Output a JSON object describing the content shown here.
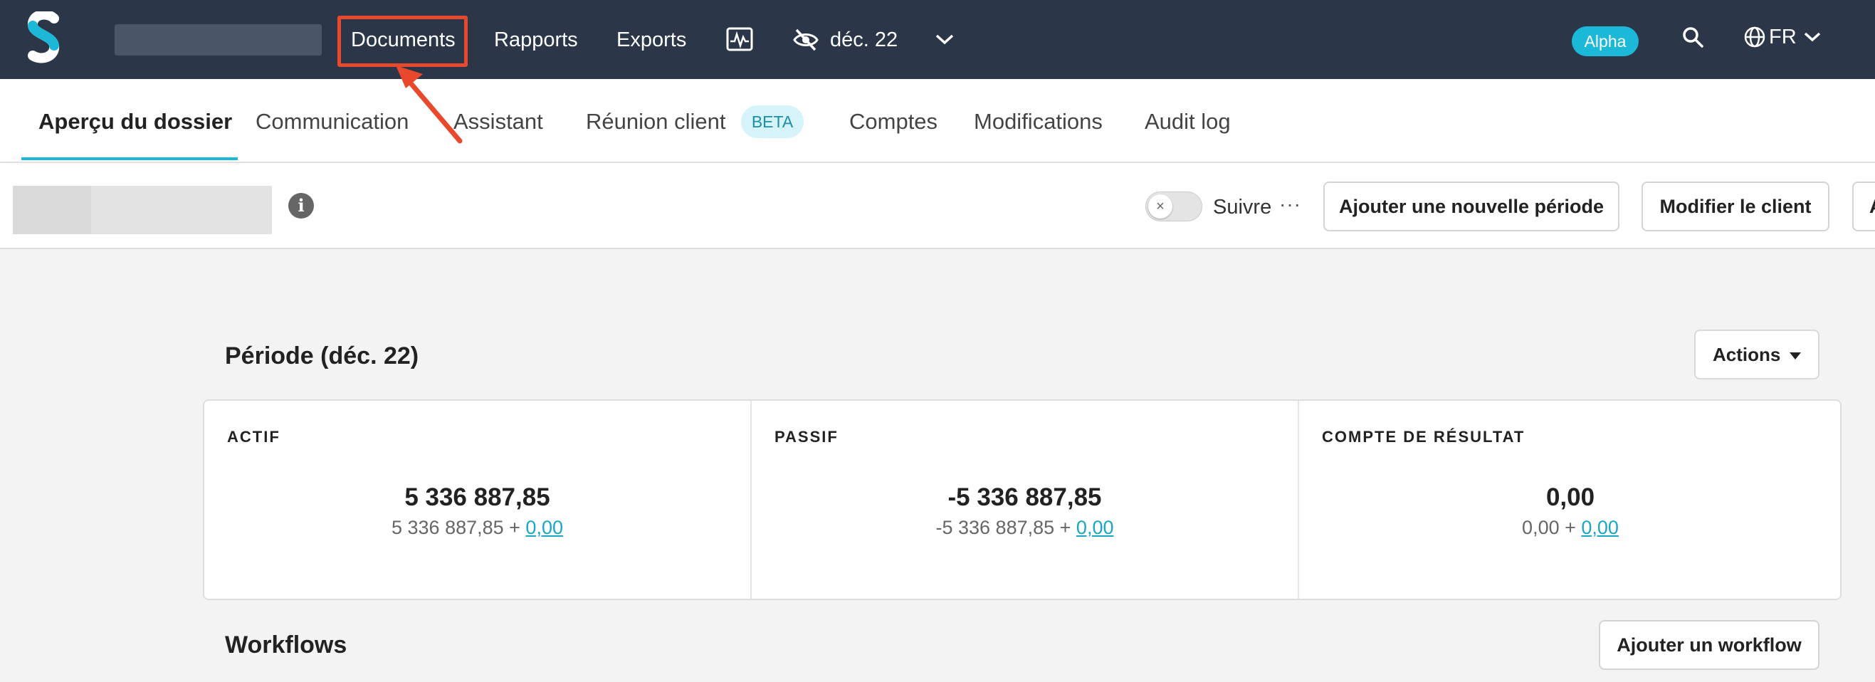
{
  "topbar": {
    "nav": {
      "documents": "Documents",
      "rapports": "Rapports",
      "exports": "Exports",
      "period": "déc. 22"
    },
    "alpha_badge": "Alpha",
    "language": "FR"
  },
  "tabs": {
    "apercu": "Aperçu du dossier",
    "communication": "Communication",
    "assistant": "Assistant",
    "reunion": "Réunion client",
    "beta": "BETA",
    "comptes": "Comptes",
    "modifications": "Modifications",
    "audit": "Audit log"
  },
  "clientbar": {
    "follow_label": "Suivre",
    "more": "···",
    "add_period": "Ajouter une nouvelle période",
    "edit_client": "Modifier le client",
    "cut_button": "A"
  },
  "period": {
    "title": "Période (déc. 22)",
    "actions_label": "Actions",
    "columns": [
      {
        "label": "ACTIF",
        "value": "5 336 887,85",
        "sub_base": "5 336 887,85 + ",
        "sub_link": "0,00"
      },
      {
        "label": "PASSIF",
        "value": "-5 336 887,85",
        "sub_base": "-5 336 887,85 + ",
        "sub_link": "0,00"
      },
      {
        "label": "COMPTE DE RÉSULTAT",
        "value": "0,00",
        "sub_base": "0,00 + ",
        "sub_link": "0,00"
      }
    ]
  },
  "workflows": {
    "title": "Workflows",
    "add_button": "Ajouter un workflow"
  },
  "colors": {
    "topbar_bg": "#2b3648",
    "accent": "#1cb8d8",
    "highlight": "#e8492d"
  },
  "icons": [
    "s-logo-icon",
    "activity-monitor-icon",
    "eye-off-icon",
    "chevron-down-icon",
    "search-icon",
    "globe-icon",
    "info-icon",
    "toggle-x-icon",
    "more-dots-icon",
    "caret-down-icon"
  ]
}
